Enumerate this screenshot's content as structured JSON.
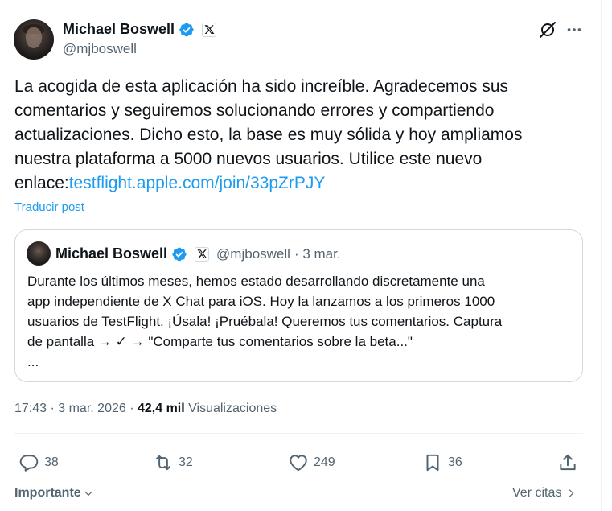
{
  "author": {
    "display_name": "Michael Boswell",
    "handle": "@mjboswell"
  },
  "tweet": {
    "text": "La acogida de esta aplicación ha sido increíble. Agradecemos sus comentarios y seguiremos solucionando errores y compartiendo actualizaciones. Dicho esto, la base es muy sólida y hoy ampliamos nuestra plataforma a 5000 nuevos usuarios. Utilice este nuevo enlace:",
    "link": "testflight.apple.com/join/33pZrPJY",
    "translate_label": "Traducir post"
  },
  "quote": {
    "display_name": "Michael Boswell",
    "handle": "@mjboswell",
    "date": "· 3 mar.",
    "lines": [
      "Durante los últimos meses, hemos estado desarrollando discretamente una",
      "app independiente de X Chat para iOS. Hoy la lanzamos a los primeros 1000",
      "usuarios de TestFlight. ¡Úsala! ¡Pruébala! Queremos tus comentarios. Captura",
      "de pantalla → ✓ → \"Comparte tus comentarios sobre la beta...\"",
      "..."
    ]
  },
  "meta": {
    "time_date": "17:43 · 3 mar. 2026 ·",
    "views_count": "42,4 mil",
    "views_label": "Visualizaciones"
  },
  "actions": {
    "replies": "38",
    "reposts": "32",
    "likes": "249",
    "bookmarks": "36"
  },
  "footer": {
    "importante": "Importante",
    "ver_citas": "Ver citas"
  },
  "colors": {
    "link": "#1d9bf0",
    "secondary_text": "#536471",
    "verified": "#1d9bf0"
  },
  "icons": [
    "verified-badge-icon",
    "x-logo-icon",
    "grok-icon",
    "more-icon",
    "reply-icon",
    "repost-icon",
    "like-icon",
    "bookmark-icon",
    "share-icon",
    "chevron-down-icon",
    "chevron-right-icon"
  ]
}
